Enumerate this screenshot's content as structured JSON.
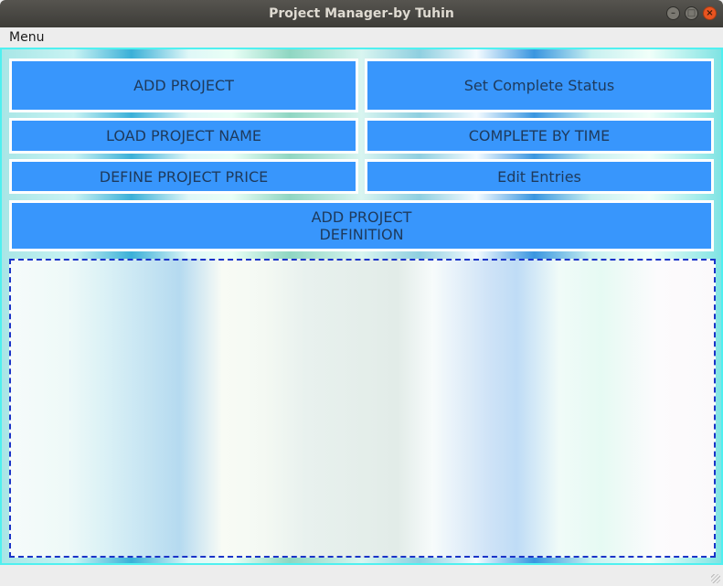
{
  "window": {
    "title": "Project Manager-by Tuhin",
    "controls": {
      "minimize_icon": "minimize-icon",
      "maximize_icon": "maximize-icon",
      "close_icon": "close-icon"
    }
  },
  "menubar": {
    "menu_label": "Menu"
  },
  "buttons": {
    "add_project": "ADD PROJECT",
    "set_complete_status": "Set Complete Status",
    "load_project_name": "LOAD PROJECT NAME",
    "complete_by_time": "COMPLETE BY TIME",
    "define_project_price": "DEFINE PROJECT PRICE",
    "edit_entries": "Edit Entries",
    "add_project_definition": "ADD PROJECT\nDEFINITION"
  },
  "text_area": {
    "value": ""
  },
  "colors": {
    "button_bg": "#3896fc",
    "button_text": "#1e3a5c",
    "panel_border": "#4ff0f0",
    "text_area_border": "#1a33c8",
    "close_button": "#e95420"
  }
}
